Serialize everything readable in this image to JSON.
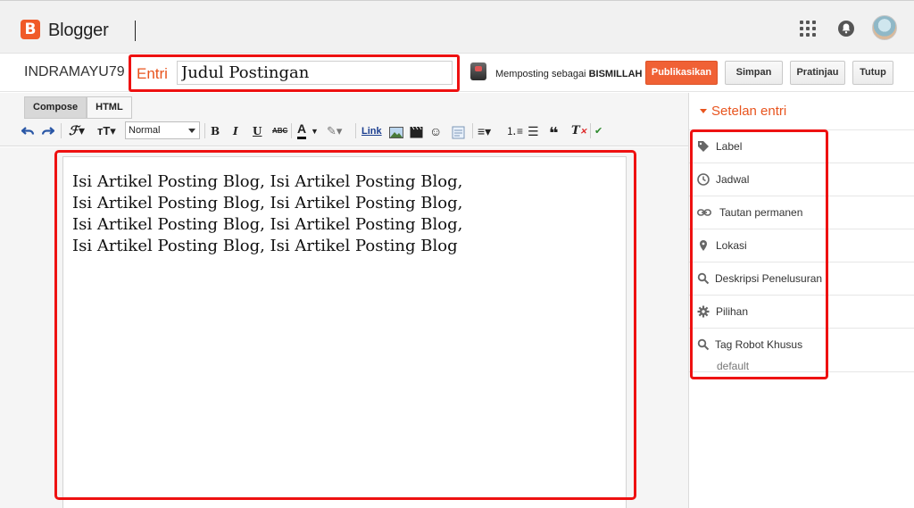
{
  "app": {
    "brand": "Blogger"
  },
  "header": {
    "blog_name": "INDRAMAYU79",
    "entry_label": "Entri",
    "title_value": "Judul Postingan",
    "posting_as_prefix": "Memposting sebagai",
    "posting_as_user": "BISMILLAH"
  },
  "actions": {
    "publish": "Publikasikan",
    "save": "Simpan",
    "preview": "Pratinjau",
    "close": "Tutup"
  },
  "mode_tabs": [
    {
      "label": "Compose",
      "active": true
    },
    {
      "label": "HTML",
      "active": false
    }
  ],
  "toolbar": {
    "format_select": "Normal",
    "link": "Link"
  },
  "editor": {
    "lines": [
      "Isi Artikel Posting Blog, Isi Artikel Posting Blog,",
      "Isi Artikel Posting Blog, Isi Artikel Posting Blog,",
      "Isi Artikel Posting Blog, Isi Artikel Posting Blog,",
      "Isi Artikel Posting Blog, Isi Artikel Posting Blog"
    ]
  },
  "sidebar": {
    "title": "Setelan entri",
    "items": [
      {
        "label": "Label",
        "icon": "tag-icon"
      },
      {
        "label": "Jadwal",
        "icon": "clock-icon"
      },
      {
        "label": "Tautan permanen",
        "icon": "link-icon"
      },
      {
        "label": "Lokasi",
        "icon": "location-pin-icon"
      },
      {
        "label": "Deskripsi Penelusuran",
        "icon": "search-icon"
      },
      {
        "label": "Pilihan",
        "icon": "gear-icon"
      },
      {
        "label": "Tag Robot Khusus",
        "icon": "search-icon"
      }
    ],
    "robot_tags_value": "default"
  },
  "colors": {
    "accent": "#e8541e",
    "publish_button": "#f06135",
    "highlight": "#ee1111"
  }
}
